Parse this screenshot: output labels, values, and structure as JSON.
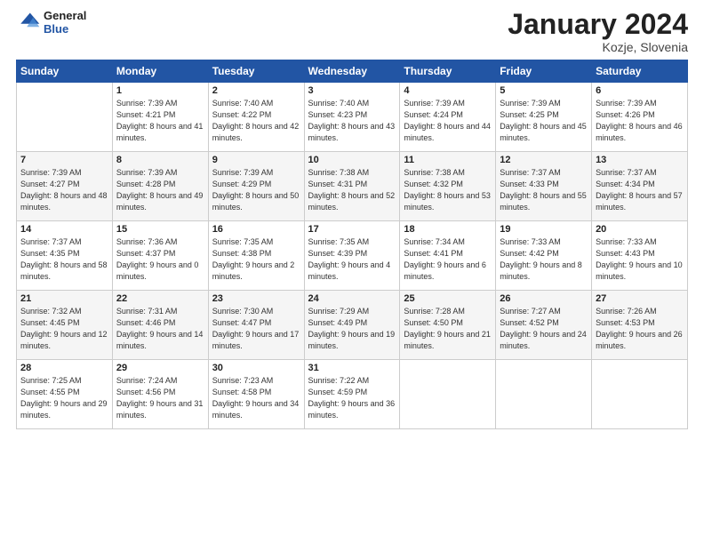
{
  "header": {
    "logo_line1": "General",
    "logo_line2": "Blue",
    "month": "January 2024",
    "location": "Kozje, Slovenia"
  },
  "weekdays": [
    "Sunday",
    "Monday",
    "Tuesday",
    "Wednesday",
    "Thursday",
    "Friday",
    "Saturday"
  ],
  "weeks": [
    [
      {
        "day": "",
        "sunrise": "",
        "sunset": "",
        "daylight": ""
      },
      {
        "day": "1",
        "sunrise": "Sunrise: 7:39 AM",
        "sunset": "Sunset: 4:21 PM",
        "daylight": "Daylight: 8 hours and 41 minutes."
      },
      {
        "day": "2",
        "sunrise": "Sunrise: 7:40 AM",
        "sunset": "Sunset: 4:22 PM",
        "daylight": "Daylight: 8 hours and 42 minutes."
      },
      {
        "day": "3",
        "sunrise": "Sunrise: 7:40 AM",
        "sunset": "Sunset: 4:23 PM",
        "daylight": "Daylight: 8 hours and 43 minutes."
      },
      {
        "day": "4",
        "sunrise": "Sunrise: 7:39 AM",
        "sunset": "Sunset: 4:24 PM",
        "daylight": "Daylight: 8 hours and 44 minutes."
      },
      {
        "day": "5",
        "sunrise": "Sunrise: 7:39 AM",
        "sunset": "Sunset: 4:25 PM",
        "daylight": "Daylight: 8 hours and 45 minutes."
      },
      {
        "day": "6",
        "sunrise": "Sunrise: 7:39 AM",
        "sunset": "Sunset: 4:26 PM",
        "daylight": "Daylight: 8 hours and 46 minutes."
      }
    ],
    [
      {
        "day": "7",
        "sunrise": "Sunrise: 7:39 AM",
        "sunset": "Sunset: 4:27 PM",
        "daylight": "Daylight: 8 hours and 48 minutes."
      },
      {
        "day": "8",
        "sunrise": "Sunrise: 7:39 AM",
        "sunset": "Sunset: 4:28 PM",
        "daylight": "Daylight: 8 hours and 49 minutes."
      },
      {
        "day": "9",
        "sunrise": "Sunrise: 7:39 AM",
        "sunset": "Sunset: 4:29 PM",
        "daylight": "Daylight: 8 hours and 50 minutes."
      },
      {
        "day": "10",
        "sunrise": "Sunrise: 7:38 AM",
        "sunset": "Sunset: 4:31 PM",
        "daylight": "Daylight: 8 hours and 52 minutes."
      },
      {
        "day": "11",
        "sunrise": "Sunrise: 7:38 AM",
        "sunset": "Sunset: 4:32 PM",
        "daylight": "Daylight: 8 hours and 53 minutes."
      },
      {
        "day": "12",
        "sunrise": "Sunrise: 7:37 AM",
        "sunset": "Sunset: 4:33 PM",
        "daylight": "Daylight: 8 hours and 55 minutes."
      },
      {
        "day": "13",
        "sunrise": "Sunrise: 7:37 AM",
        "sunset": "Sunset: 4:34 PM",
        "daylight": "Daylight: 8 hours and 57 minutes."
      }
    ],
    [
      {
        "day": "14",
        "sunrise": "Sunrise: 7:37 AM",
        "sunset": "Sunset: 4:35 PM",
        "daylight": "Daylight: 8 hours and 58 minutes."
      },
      {
        "day": "15",
        "sunrise": "Sunrise: 7:36 AM",
        "sunset": "Sunset: 4:37 PM",
        "daylight": "Daylight: 9 hours and 0 minutes."
      },
      {
        "day": "16",
        "sunrise": "Sunrise: 7:35 AM",
        "sunset": "Sunset: 4:38 PM",
        "daylight": "Daylight: 9 hours and 2 minutes."
      },
      {
        "day": "17",
        "sunrise": "Sunrise: 7:35 AM",
        "sunset": "Sunset: 4:39 PM",
        "daylight": "Daylight: 9 hours and 4 minutes."
      },
      {
        "day": "18",
        "sunrise": "Sunrise: 7:34 AM",
        "sunset": "Sunset: 4:41 PM",
        "daylight": "Daylight: 9 hours and 6 minutes."
      },
      {
        "day": "19",
        "sunrise": "Sunrise: 7:33 AM",
        "sunset": "Sunset: 4:42 PM",
        "daylight": "Daylight: 9 hours and 8 minutes."
      },
      {
        "day": "20",
        "sunrise": "Sunrise: 7:33 AM",
        "sunset": "Sunset: 4:43 PM",
        "daylight": "Daylight: 9 hours and 10 minutes."
      }
    ],
    [
      {
        "day": "21",
        "sunrise": "Sunrise: 7:32 AM",
        "sunset": "Sunset: 4:45 PM",
        "daylight": "Daylight: 9 hours and 12 minutes."
      },
      {
        "day": "22",
        "sunrise": "Sunrise: 7:31 AM",
        "sunset": "Sunset: 4:46 PM",
        "daylight": "Daylight: 9 hours and 14 minutes."
      },
      {
        "day": "23",
        "sunrise": "Sunrise: 7:30 AM",
        "sunset": "Sunset: 4:47 PM",
        "daylight": "Daylight: 9 hours and 17 minutes."
      },
      {
        "day": "24",
        "sunrise": "Sunrise: 7:29 AM",
        "sunset": "Sunset: 4:49 PM",
        "daylight": "Daylight: 9 hours and 19 minutes."
      },
      {
        "day": "25",
        "sunrise": "Sunrise: 7:28 AM",
        "sunset": "Sunset: 4:50 PM",
        "daylight": "Daylight: 9 hours and 21 minutes."
      },
      {
        "day": "26",
        "sunrise": "Sunrise: 7:27 AM",
        "sunset": "Sunset: 4:52 PM",
        "daylight": "Daylight: 9 hours and 24 minutes."
      },
      {
        "day": "27",
        "sunrise": "Sunrise: 7:26 AM",
        "sunset": "Sunset: 4:53 PM",
        "daylight": "Daylight: 9 hours and 26 minutes."
      }
    ],
    [
      {
        "day": "28",
        "sunrise": "Sunrise: 7:25 AM",
        "sunset": "Sunset: 4:55 PM",
        "daylight": "Daylight: 9 hours and 29 minutes."
      },
      {
        "day": "29",
        "sunrise": "Sunrise: 7:24 AM",
        "sunset": "Sunset: 4:56 PM",
        "daylight": "Daylight: 9 hours and 31 minutes."
      },
      {
        "day": "30",
        "sunrise": "Sunrise: 7:23 AM",
        "sunset": "Sunset: 4:58 PM",
        "daylight": "Daylight: 9 hours and 34 minutes."
      },
      {
        "day": "31",
        "sunrise": "Sunrise: 7:22 AM",
        "sunset": "Sunset: 4:59 PM",
        "daylight": "Daylight: 9 hours and 36 minutes."
      },
      {
        "day": "",
        "sunrise": "",
        "sunset": "",
        "daylight": ""
      },
      {
        "day": "",
        "sunrise": "",
        "sunset": "",
        "daylight": ""
      },
      {
        "day": "",
        "sunrise": "",
        "sunset": "",
        "daylight": ""
      }
    ]
  ]
}
